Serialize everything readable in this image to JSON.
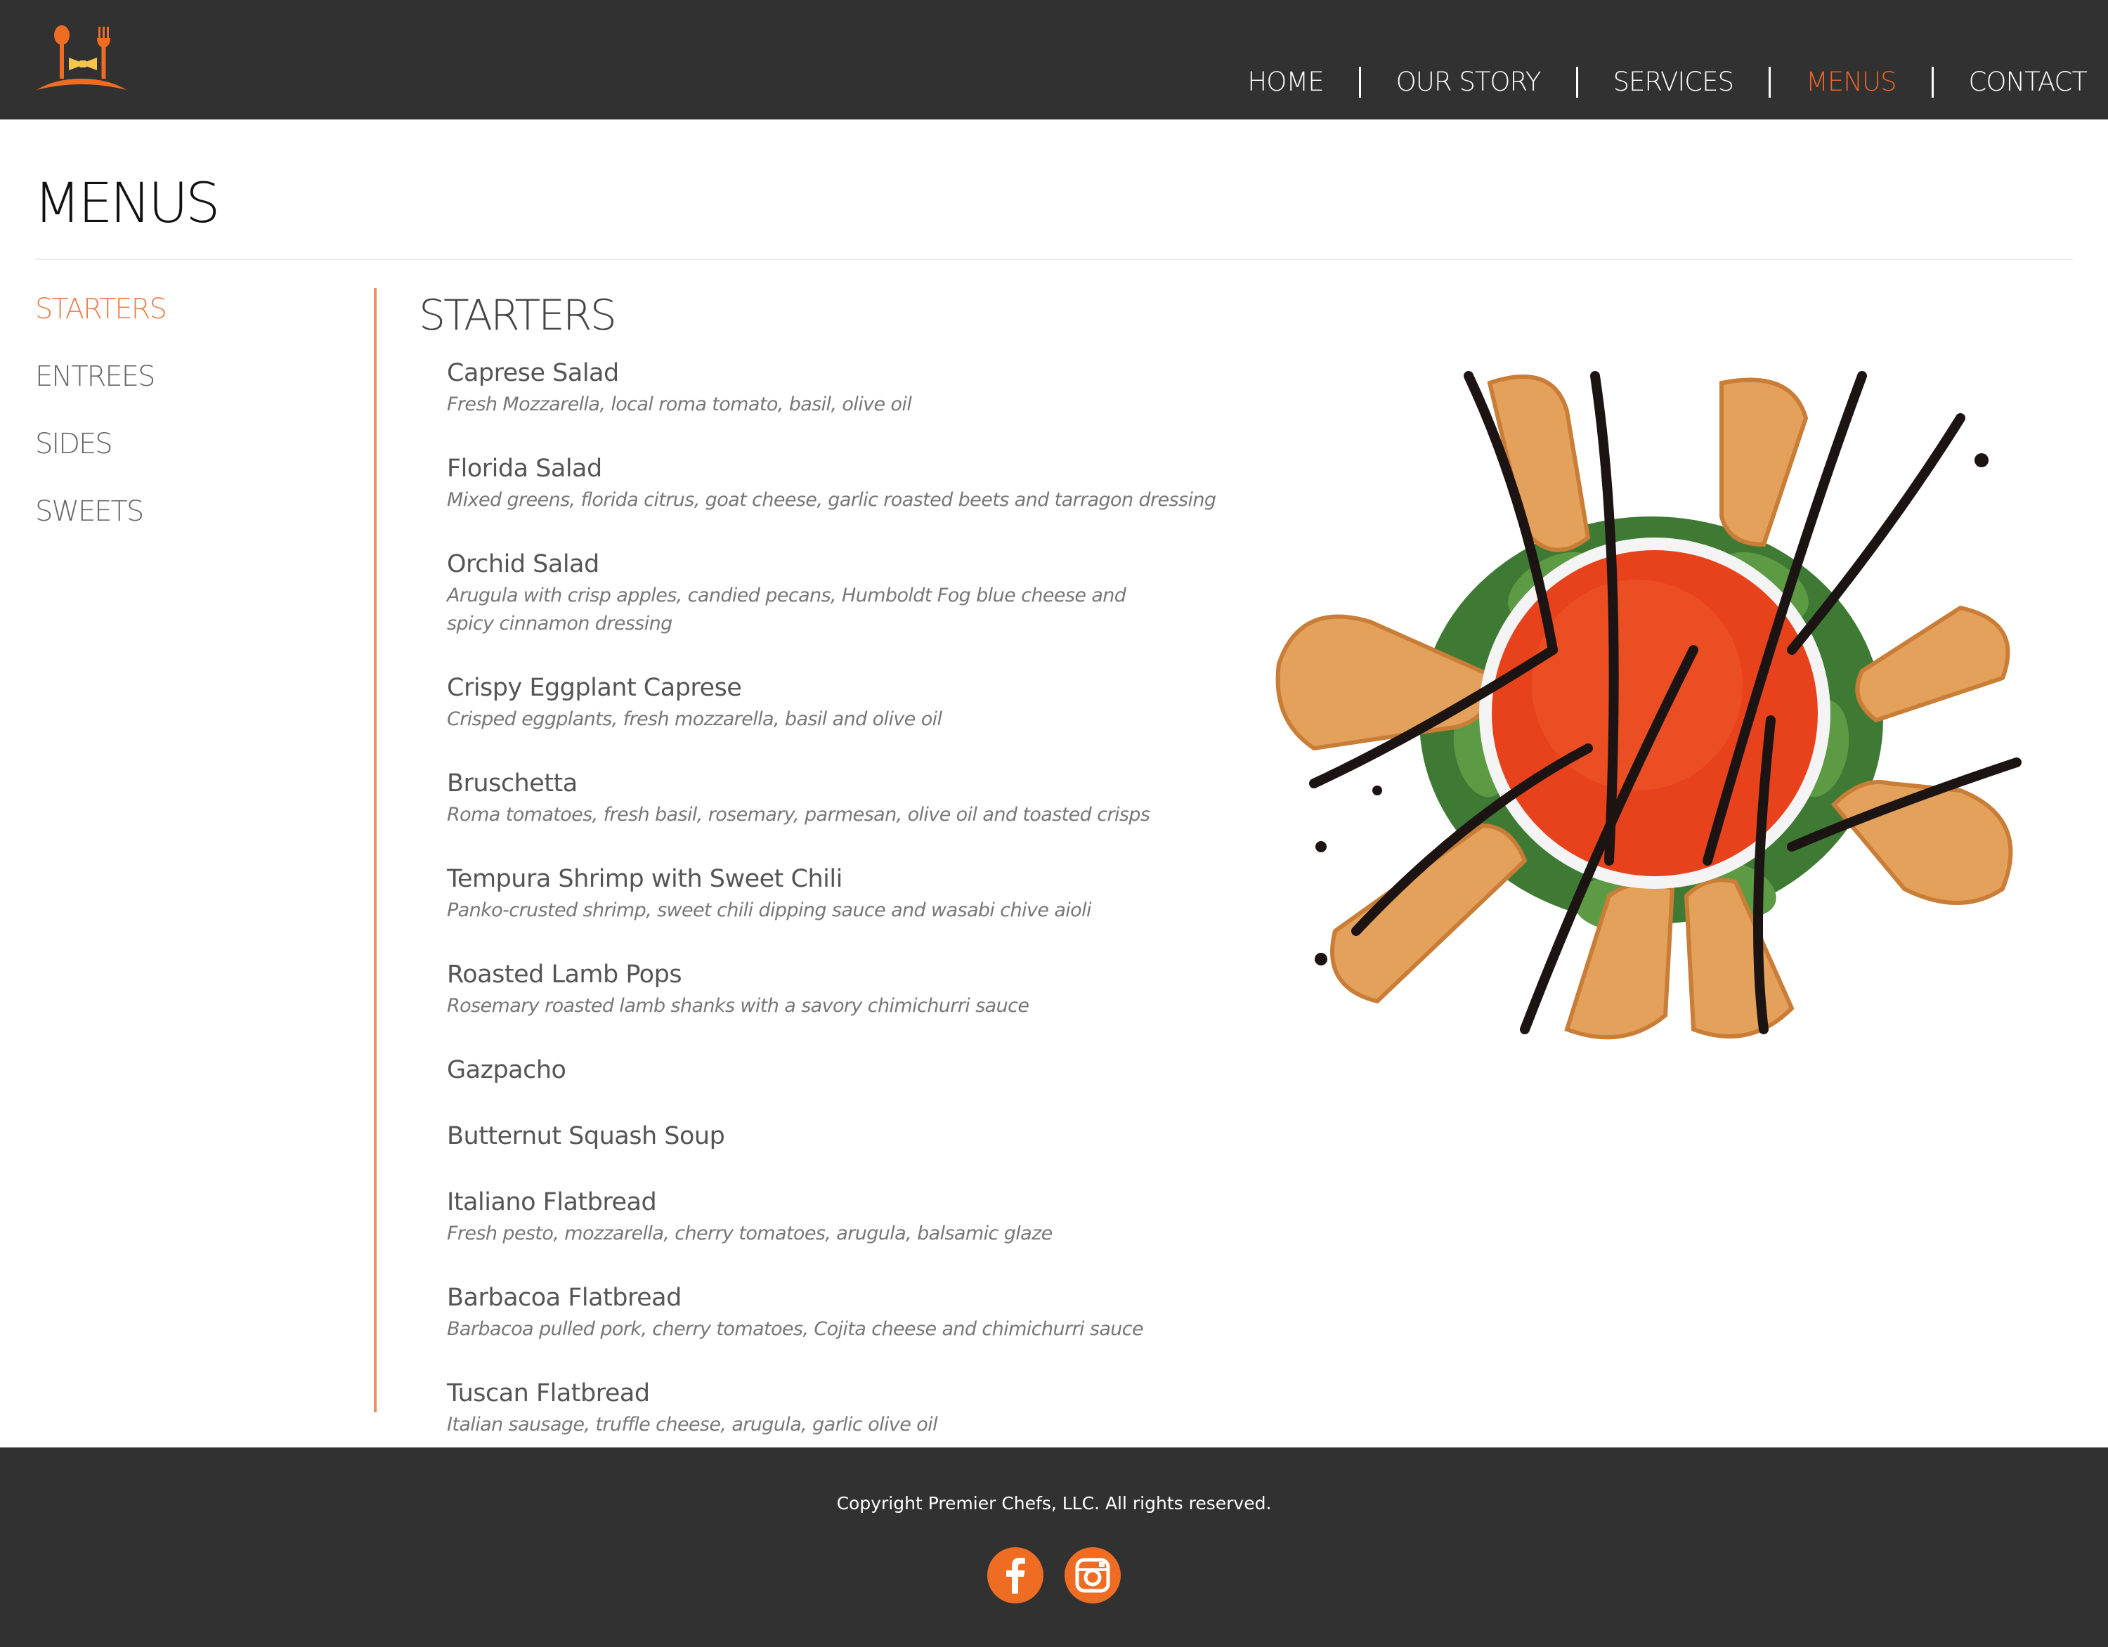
{
  "header": {
    "logo_icon": "spoon-fork-bowtie-logo",
    "nav": [
      {
        "label": "HOME",
        "active": false
      },
      {
        "label": "OUR STORY",
        "active": false
      },
      {
        "label": "SERVICES",
        "active": false
      },
      {
        "label": "MENUS",
        "active": true
      },
      {
        "label": "CONTACT",
        "active": false
      }
    ]
  },
  "page": {
    "title": "MENUS"
  },
  "sidebar": {
    "items": [
      {
        "label": "STARTERS",
        "active": true
      },
      {
        "label": "ENTREES",
        "active": false
      },
      {
        "label": "SIDES",
        "active": false
      },
      {
        "label": "SWEETS",
        "active": false
      }
    ]
  },
  "section": {
    "title": "STARTERS",
    "items": [
      {
        "name": "Caprese Salad",
        "desc": "Fresh Mozzarella, local roma tomato, basil, olive oil"
      },
      {
        "name": "Florida Salad",
        "desc": "Mixed greens, florida citrus, goat cheese, garlic roasted beets and tarragon dressing"
      },
      {
        "name": "Orchid Salad",
        "desc": "Arugula with crisp apples, candied pecans, Humboldt Fog blue cheese and spicy cinnamon dressing"
      },
      {
        "name": "Crispy Eggplant Caprese",
        "desc": "Crisped eggplants, fresh mozzarella, basil and olive oil"
      },
      {
        "name": "Bruschetta",
        "desc": "Roma tomatoes, fresh basil, rosemary, parmesan, olive oil and toasted crisps"
      },
      {
        "name": "Tempura Shrimp with Sweet Chili",
        "desc": "Panko-crusted shrimp, sweet chili dipping sauce and wasabi chive aioli"
      },
      {
        "name": "Roasted Lamb Pops",
        "desc": "Rosemary roasted lamb shanks with a savory chimichurri sauce"
      },
      {
        "name": "Gazpacho",
        "desc": ""
      },
      {
        "name": "Butternut Squash Soup",
        "desc": ""
      },
      {
        "name": "Italiano Flatbread",
        "desc": "Fresh pesto, mozzarella, cherry tomatoes, arugula, balsamic glaze"
      },
      {
        "name": "Barbacoa Flatbread",
        "desc": "Barbacoa pulled pork, cherry tomatoes, Cojita cheese and chimichurri sauce"
      },
      {
        "name": "Tuscan Flatbread",
        "desc": "Italian sausage, truffle cheese, arugula, garlic olive oil"
      }
    ],
    "image": "starter-platter-photo"
  },
  "footer": {
    "copyright": "Copyright Premier Chefs, LLC. All rights reserved.",
    "social": [
      "facebook-icon",
      "instagram-icon"
    ]
  },
  "colors": {
    "header_bg": "#313131",
    "accent": "#e8652c",
    "sidebar_active": "#e8834f",
    "divider": "#e9936a",
    "social_bg": "#ef6d23"
  }
}
